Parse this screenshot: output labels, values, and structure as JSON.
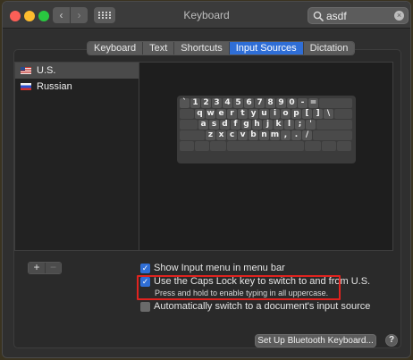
{
  "window": {
    "title": "Keyboard"
  },
  "search": {
    "value": "asdf"
  },
  "tabs": [
    {
      "label": "Keyboard"
    },
    {
      "label": "Text"
    },
    {
      "label": "Shortcuts"
    },
    {
      "label": "Input Sources",
      "active": true
    },
    {
      "label": "Dictation"
    }
  ],
  "input_sources": [
    {
      "label": "U.S.",
      "flag": "us-flag-icon",
      "selected": true
    },
    {
      "label": "Russian",
      "flag": "russia-flag-icon",
      "selected": false
    }
  ],
  "keyboard_preview": {
    "rows": [
      [
        "`",
        "1",
        "2",
        "3",
        "4",
        "5",
        "6",
        "7",
        "8",
        "9",
        "0",
        "-",
        "="
      ],
      [
        "q",
        "w",
        "e",
        "r",
        "t",
        "y",
        "u",
        "i",
        "o",
        "p",
        "[",
        "]",
        "\\"
      ],
      [
        "a",
        "s",
        "d",
        "f",
        "g",
        "h",
        "j",
        "k",
        "l",
        ";",
        "'"
      ],
      [
        "z",
        "x",
        "c",
        "v",
        "b",
        "n",
        "m",
        ",",
        ".",
        "/"
      ]
    ]
  },
  "list_controls": {
    "add_label": "+",
    "remove_label": "−"
  },
  "options": {
    "show_input_menu": {
      "label": "Show Input menu in menu bar",
      "checked": true
    },
    "caps_lock": {
      "label": "Use the Caps Lock key to switch to and from U.S.",
      "checked": true,
      "sublabel": "Press and hold to enable typing in all uppercase."
    },
    "auto_switch": {
      "label": "Automatically switch to a document's input source",
      "checked": false
    }
  },
  "buttons": {
    "bluetooth_label": "Set Up Bluetooth Keyboard...",
    "help_label": "?"
  },
  "colors": {
    "accent": "#2f6ed6",
    "highlight_box": "#e0231f"
  }
}
